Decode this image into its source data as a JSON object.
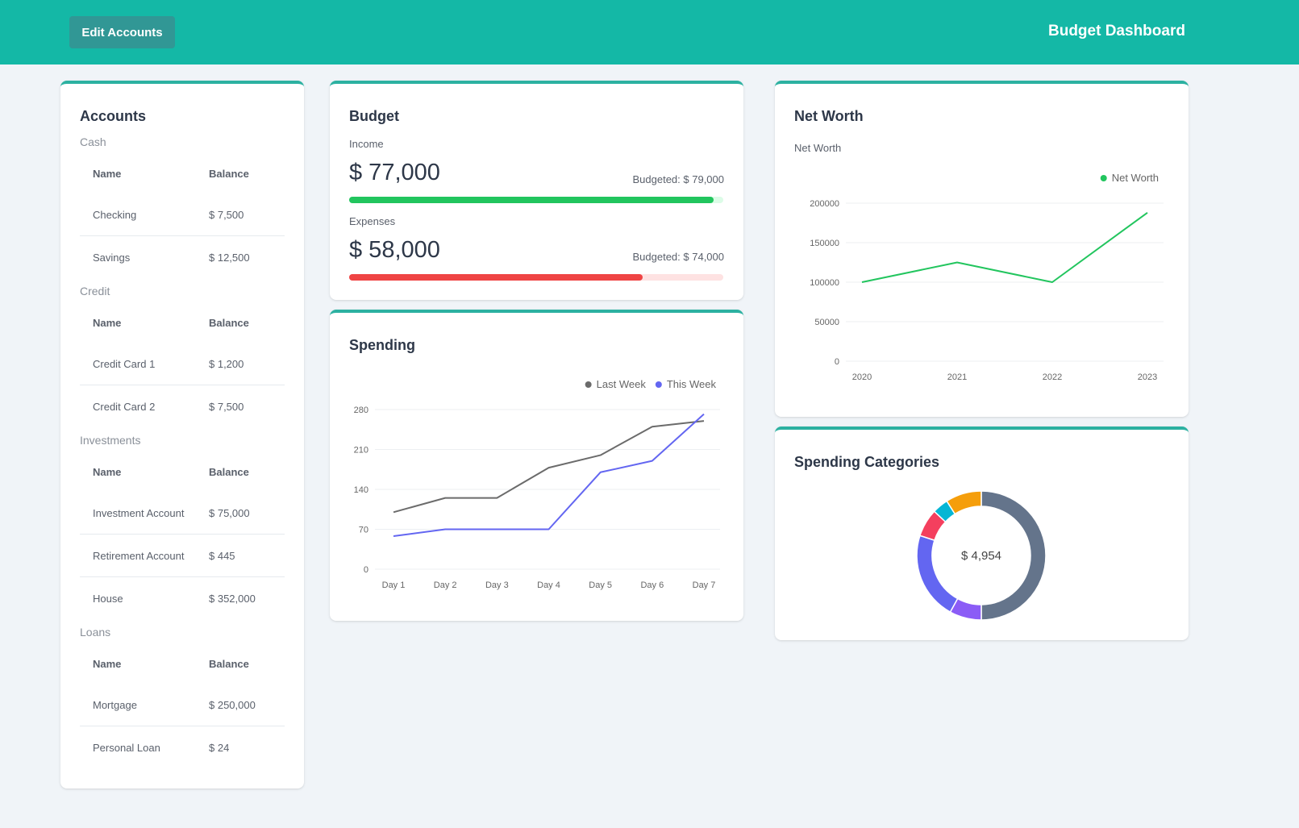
{
  "header": {
    "edit_button": "Edit Accounts",
    "title": "Budget Dashboard",
    "brand_color": "#14b8a6"
  },
  "accounts": {
    "title": "Accounts",
    "columns": {
      "name": "Name",
      "balance": "Balance"
    },
    "groups": [
      {
        "label": "Cash",
        "rows": [
          {
            "name": "Checking",
            "balance": "$ 7,500"
          },
          {
            "name": "Savings",
            "balance": "$ 12,500"
          }
        ]
      },
      {
        "label": "Credit",
        "rows": [
          {
            "name": "Credit Card 1",
            "balance": "$ 1,200"
          },
          {
            "name": "Credit Card 2",
            "balance": "$ 7,500"
          }
        ]
      },
      {
        "label": "Investments",
        "rows": [
          {
            "name": "Investment Account",
            "balance": "$ 75,000"
          },
          {
            "name": "Retirement Account",
            "balance": "$ 445"
          },
          {
            "name": "House",
            "balance": "$ 352,000"
          }
        ]
      },
      {
        "label": "Loans",
        "rows": [
          {
            "name": "Mortgage",
            "balance": "$ 250,000"
          },
          {
            "name": "Personal Loan",
            "balance": "$ 24"
          }
        ]
      }
    ]
  },
  "budget": {
    "title": "Budget",
    "income": {
      "label": "Income",
      "amount": "$ 77,000",
      "budgeted": "Budgeted: $ 79,000",
      "progress": 0.975,
      "color": "#22c55e",
      "track_color": "#dcfce7"
    },
    "expenses": {
      "label": "Expenses",
      "amount": "$ 58,000",
      "budgeted": "Budgeted: $ 74,000",
      "progress": 0.784,
      "color": "#ef4444",
      "track_color": "#fee2e2"
    }
  },
  "chart_data": [
    {
      "id": "spending",
      "type": "line",
      "title": "Spending",
      "categories": [
        "Day 1",
        "Day 2",
        "Day 3",
        "Day 4",
        "Day 5",
        "Day 6",
        "Day 7"
      ],
      "series": [
        {
          "name": "Last Week",
          "color": "#6b6b6b",
          "values": [
            100,
            125,
            125,
            178,
            200,
            250,
            260
          ]
        },
        {
          "name": "This Week",
          "color": "#6366f1",
          "values": [
            58,
            70,
            70,
            70,
            170,
            190,
            272
          ]
        }
      ],
      "yticks": [
        0,
        70,
        140,
        210,
        280
      ],
      "ylim": [
        0,
        280
      ],
      "xlabel": "",
      "ylabel": "",
      "grid": true,
      "legend": "top-right"
    },
    {
      "id": "net_worth",
      "type": "line",
      "title": "Net Worth",
      "subtitle": "Net Worth",
      "categories": [
        "2020",
        "2021",
        "2022",
        "2023"
      ],
      "series": [
        {
          "name": "Net Worth",
          "color": "#22c55e",
          "values": [
            100000,
            125000,
            100000,
            188000
          ]
        }
      ],
      "yticks": [
        0,
        50000,
        100000,
        150000,
        200000
      ],
      "ylim": [
        0,
        200000
      ],
      "xlabel": "",
      "ylabel": "",
      "grid": true,
      "legend": "top-right"
    },
    {
      "id": "spending_categories",
      "type": "pie",
      "title": "Spending Categories",
      "center_label": "$ 4,954",
      "slices": [
        {
          "color": "#64748b",
          "value": 0.5
        },
        {
          "color": "#8b5cf6",
          "value": 0.08
        },
        {
          "color": "#6366f1",
          "value": 0.22
        },
        {
          "color": "#f43f5e",
          "value": 0.07
        },
        {
          "color": "#06b6d4",
          "value": 0.04
        },
        {
          "color": "#f59e0b",
          "value": 0.09
        }
      ]
    }
  ]
}
